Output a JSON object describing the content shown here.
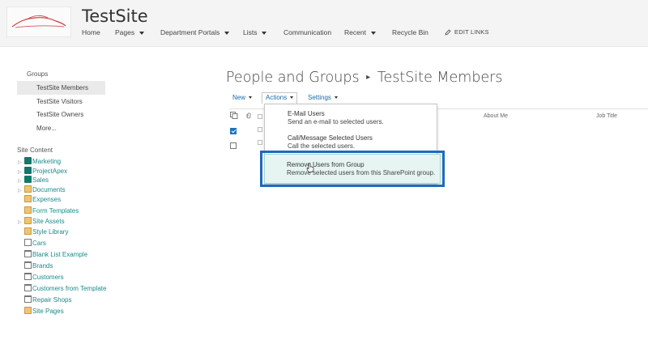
{
  "header": {
    "site_title": "TestSite",
    "nav": [
      {
        "label": "Home",
        "has_menu": false
      },
      {
        "label": "Pages",
        "has_menu": true
      },
      {
        "label": "Department Portals",
        "has_menu": true
      },
      {
        "label": "Lists",
        "has_menu": true
      },
      {
        "label": "Communication",
        "has_menu": false
      },
      {
        "label": "Recent",
        "has_menu": true
      },
      {
        "label": "Recycle Bin",
        "has_menu": false
      }
    ],
    "edit_links": "EDIT LINKS"
  },
  "sidebar": {
    "groups_heading": "Groups",
    "groups": [
      {
        "label": "TestSite Members",
        "selected": true
      },
      {
        "label": "TestSite Visitors",
        "selected": false
      },
      {
        "label": "TestSite Owners",
        "selected": false
      },
      {
        "label": "More...",
        "selected": false
      }
    ],
    "site_content_heading": "Site Content",
    "site_content": [
      {
        "label": "Marketing",
        "icon": "subsite-icon",
        "expandable": true
      },
      {
        "label": "ProjectApex",
        "icon": "subsite-icon",
        "expandable": true
      },
      {
        "label": "Sales",
        "icon": "subsite-icon",
        "expandable": true
      },
      {
        "label": "Documents",
        "icon": "document-library-icon",
        "expandable": true
      },
      {
        "label": "Expenses",
        "icon": "document-library-icon",
        "expandable": false
      },
      {
        "label": "Form Templates",
        "icon": "document-library-icon",
        "expandable": false
      },
      {
        "label": "Site Assets",
        "icon": "document-library-icon",
        "expandable": true
      },
      {
        "label": "Style Library",
        "icon": "document-library-icon",
        "expandable": false
      },
      {
        "label": "Cars",
        "icon": "picture-library-icon",
        "expandable": false
      },
      {
        "label": "Blank List Example",
        "icon": "list-icon",
        "expandable": false
      },
      {
        "label": "Brands",
        "icon": "list-icon",
        "expandable": false
      },
      {
        "label": "Customers",
        "icon": "list-icon",
        "expandable": false
      },
      {
        "label": "Customers from Template",
        "icon": "list-icon",
        "expandable": false
      },
      {
        "label": "Repair Shops",
        "icon": "list-icon",
        "expandable": false
      },
      {
        "label": "Site Pages",
        "icon": "document-library-icon",
        "expandable": false
      }
    ]
  },
  "main": {
    "breadcrumb_parent": "People and Groups",
    "breadcrumb_separator": "▸",
    "breadcrumb_current": "TestSite Members",
    "toolbar": {
      "new_label": "New",
      "actions_label": "Actions",
      "settings_label": "Settings"
    },
    "columns": {
      "about_me": "About Me",
      "job_title": "Job Title"
    },
    "rows": [
      {
        "checked": true
      },
      {
        "checked": false
      }
    ]
  },
  "actions_menu": {
    "items": [
      {
        "title": "E-Mail Users",
        "description": "Send an e-mail to selected users.",
        "highlighted": false
      },
      {
        "title": "Call/Message Selected Users",
        "description": "Call the selected users.",
        "highlighted": false
      },
      {
        "title": "Remove Users from Group",
        "description": "Remove selected users from this SharePoint group.",
        "highlighted": true
      }
    ]
  },
  "colors": {
    "header_bg": "#f4f4f4",
    "link_teal": "#1a8a8a",
    "toolbar_blue": "#1a6aa8",
    "highlight_border": "#1f69bf",
    "highlight_fill": "#e6f5f2",
    "checkbox_checked": "#1f73b7"
  }
}
